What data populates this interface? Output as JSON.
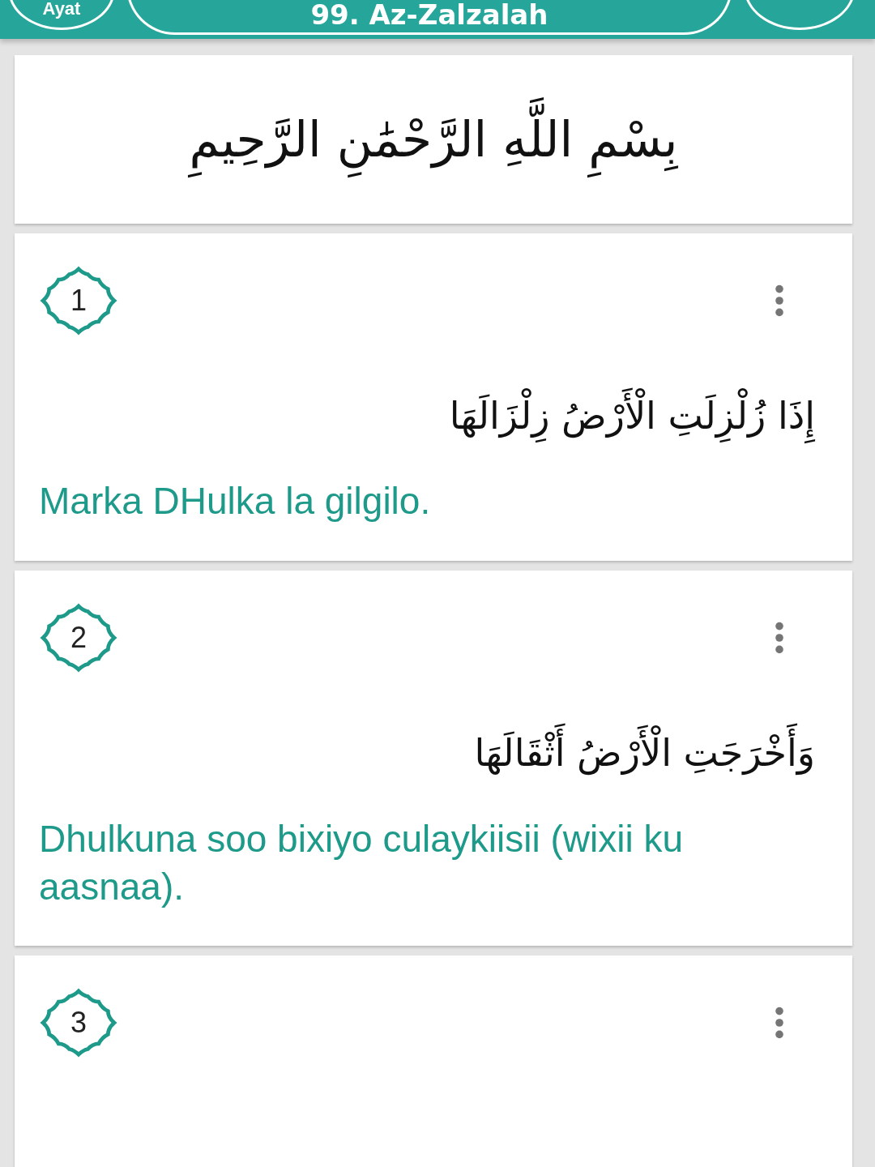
{
  "header": {
    "left_button": "Ayat",
    "title": "99. Az-Zalzalah"
  },
  "bismillah": "بِسْمِ اللَّهِ الرَّحْمَٰنِ الرَّحِيمِ",
  "verses": [
    {
      "number": "1",
      "arabic": "إِذَا زُلْزِلَتِ الْأَرْضُ زِلْزَالَهَا",
      "translation": "Marka DHulka la gilgilo."
    },
    {
      "number": "2",
      "arabic": "وَأَخْرَجَتِ الْأَرْضُ أَثْقَالَهَا",
      "translation": "Dhulkuna soo bixiyo culaykiisii (wixii ku aasnaa)."
    },
    {
      "number": "3"
    }
  ]
}
